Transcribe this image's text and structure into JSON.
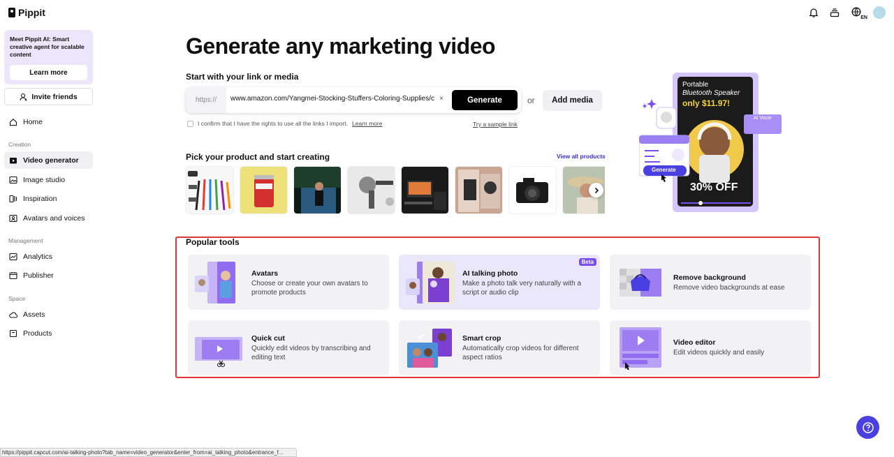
{
  "app": {
    "name": "Pippit"
  },
  "promo": {
    "text": "Meet Pippit AI: Smart creative agent for scalable content",
    "button": "Learn more"
  },
  "invite": {
    "label": "Invite friends"
  },
  "nav": {
    "home": "Home",
    "creation_header": "Creation",
    "video_generator": "Video generator",
    "image_studio": "Image studio",
    "inspiration": "Inspiration",
    "avatars_voices": "Avatars and voices",
    "management_header": "Management",
    "analytics": "Analytics",
    "publisher": "Publisher",
    "space_header": "Space",
    "assets": "Assets",
    "products": "Products"
  },
  "topbar": {
    "language": "EN"
  },
  "main": {
    "title": "Generate any marketing video",
    "subtitle": "Start with your link or media",
    "url_prefix": "https://",
    "url_value": "www.amazon.com/Yangmei-Stocking-Stuffers-Coloring-Supplies/c",
    "url_clear": "×",
    "generate": "Generate",
    "or": "or",
    "add_media": "Add media",
    "confirm_text": "I confirm that I have the rights to use all the links I import.",
    "confirm_link": "Learn more",
    "sample_link": "Try a sample link",
    "pick_title": "Pick your product and start creating",
    "view_all": "View all products"
  },
  "hero": {
    "line1": "Portable",
    "line2": "Bluetooth Speaker",
    "price": "only $11.97!",
    "ai_voice": "AI Vocie",
    "generate": "Generate",
    "discount": "30% OFF"
  },
  "tools": {
    "title": "Popular tools",
    "items": [
      {
        "name": "Avatars",
        "desc": "Choose or create your own avatars to promote products"
      },
      {
        "name": "AI talking photo",
        "desc": "Make a photo talk very naturally with a script or audio clip",
        "badge": "Beta"
      },
      {
        "name": "Remove background",
        "desc": "Remove video backgrounds at ease"
      },
      {
        "name": "Quick cut",
        "desc": "Quickly edit videos by transcribing and editing text"
      },
      {
        "name": "Smart crop",
        "desc": "Automatically crop videos for different aspect ratios"
      },
      {
        "name": "Video editor",
        "desc": "Edit videos quickly and easily"
      }
    ]
  },
  "statusbar": {
    "url": "https://pippit.capcut.com/ai-talking-photo?tab_name=video_generator&enter_from=ai_talking_photo&entrance_f..."
  },
  "colors": {
    "accent": "#7a4ff0",
    "brand_blue": "#4a3fe0",
    "highlight_border": "#e0363a"
  }
}
